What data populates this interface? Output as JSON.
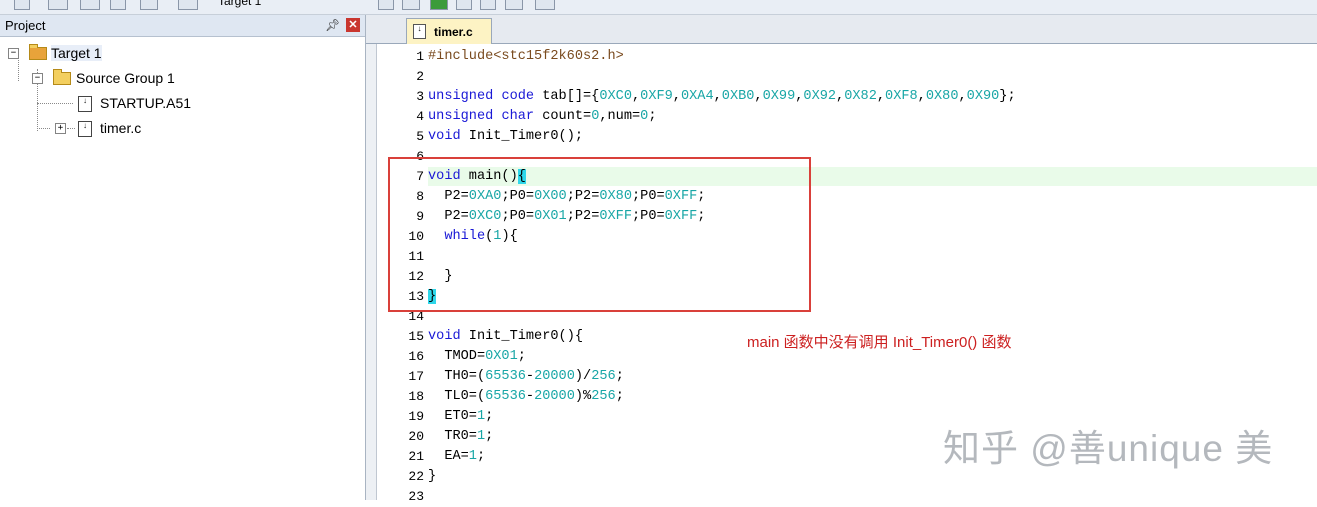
{
  "toolbar": {
    "target_label": "Target 1"
  },
  "project_panel": {
    "title": "Project",
    "pin_icon": "pin-icon",
    "close_icon": "close-icon",
    "tree": [
      {
        "label": "Target 1",
        "icon": "target-icon",
        "expander": "⊟"
      },
      {
        "label": "Source Group 1",
        "icon": "folder-icon",
        "expander": "⊟"
      },
      {
        "label": "STARTUP.A51",
        "icon": "file-icon"
      },
      {
        "label": "timer.c",
        "icon": "file-icon",
        "expander": "⊞"
      }
    ]
  },
  "editor": {
    "tab_label": "timer.c",
    "active_line": 7,
    "lines": [
      {
        "n": "1",
        "text": "#include<stc15f2k60s2.h>"
      },
      {
        "n": "2",
        "text": ""
      },
      {
        "n": "3",
        "text": "unsigned code tab[]={0XC0,0XF9,0XA4,0XB0,0X99,0X92,0X82,0XF8,0X80,0X90};"
      },
      {
        "n": "4",
        "text": "unsigned char count=0,num=0;"
      },
      {
        "n": "5",
        "text": "void Init_Timer0();"
      },
      {
        "n": "6",
        "text": ""
      },
      {
        "n": "7",
        "text": "void main(){"
      },
      {
        "n": "8",
        "text": "  P2=0XA0;P0=0X00;P2=0X80;P0=0XFF;"
      },
      {
        "n": "9",
        "text": "  P2=0XC0;P0=0X01;P2=0XFF;P0=0XFF;"
      },
      {
        "n": "10",
        "text": "  while(1){"
      },
      {
        "n": "11",
        "text": ""
      },
      {
        "n": "12",
        "text": "  }"
      },
      {
        "n": "13",
        "text": "}"
      },
      {
        "n": "14",
        "text": ""
      },
      {
        "n": "15",
        "text": "void Init_Timer0(){"
      },
      {
        "n": "16",
        "text": "  TMOD=0X01;"
      },
      {
        "n": "17",
        "text": "  TH0=(65536-20000)/256;"
      },
      {
        "n": "18",
        "text": "  TL0=(65536-20000)%256;"
      },
      {
        "n": "19",
        "text": "  ET0=1;"
      },
      {
        "n": "20",
        "text": "  TR0=1;"
      },
      {
        "n": "21",
        "text": "  EA=1;"
      },
      {
        "n": "22",
        "text": "}"
      },
      {
        "n": "23",
        "text": ""
      }
    ]
  },
  "annotation": {
    "text": "main 函数中没有调用 Init_Timer0() 函数",
    "color": "#cc2020"
  },
  "watermark": {
    "text": "知乎 @善unique 美"
  },
  "colors": {
    "keyword": "#1a19d6",
    "number": "#18a6a6",
    "preprocessor": "#7a4b1f",
    "highlight_box": "#d9403a"
  }
}
